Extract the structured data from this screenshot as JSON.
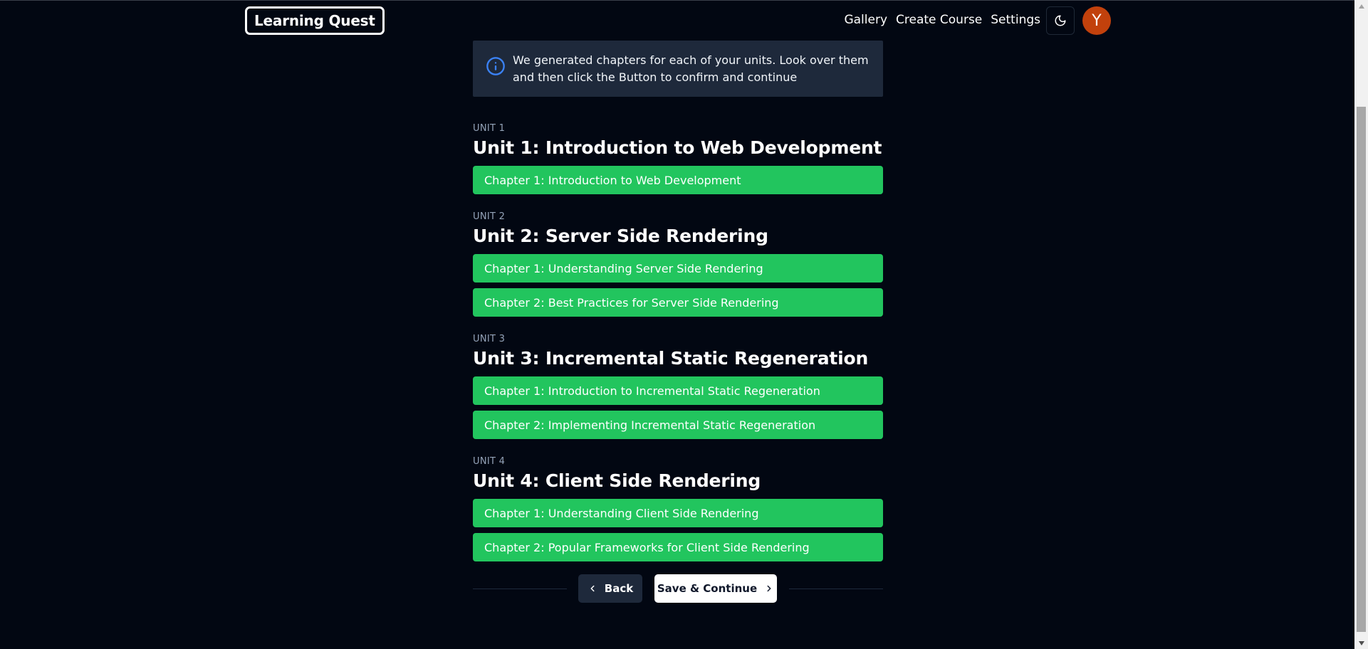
{
  "nav": {
    "logo": "Learning Quest",
    "links": [
      "Gallery",
      "Create Course",
      "Settings"
    ],
    "avatar_initial": "Y"
  },
  "info": {
    "message": "We generated chapters for each of your units. Look over them and then click the Button to confirm and continue"
  },
  "units": [
    {
      "label": "UNIT 1",
      "title": "Unit 1: Introduction to Web Development",
      "chapters": [
        "Chapter 1: Introduction to Web Development"
      ]
    },
    {
      "label": "UNIT 2",
      "title": "Unit 2: Server Side Rendering",
      "chapters": [
        "Chapter 1: Understanding Server Side Rendering",
        "Chapter 2: Best Practices for Server Side Rendering"
      ]
    },
    {
      "label": "UNIT 3",
      "title": "Unit 3: Incremental Static Regeneration",
      "chapters": [
        "Chapter 1: Introduction to Incremental Static Regeneration",
        "Chapter 2: Implementing Incremental Static Regeneration"
      ]
    },
    {
      "label": "UNIT 4",
      "title": "Unit 4: Client Side Rendering",
      "chapters": [
        "Chapter 1: Understanding Client Side Rendering",
        "Chapter 2: Popular Frameworks for Client Side Rendering"
      ]
    }
  ],
  "actions": {
    "back_label": "Back",
    "save_label": "Save & Continue"
  },
  "colors": {
    "background": "#020712",
    "chapter_green": "#22c55e",
    "info_bg": "#1e293b",
    "avatar_bg": "#c2410c",
    "info_icon": "#3b82f6"
  },
  "icons": {
    "theme_toggle": "moon-icon",
    "info": "info-icon",
    "back": "chevron-left-icon",
    "save": "chevron-right-icon"
  }
}
